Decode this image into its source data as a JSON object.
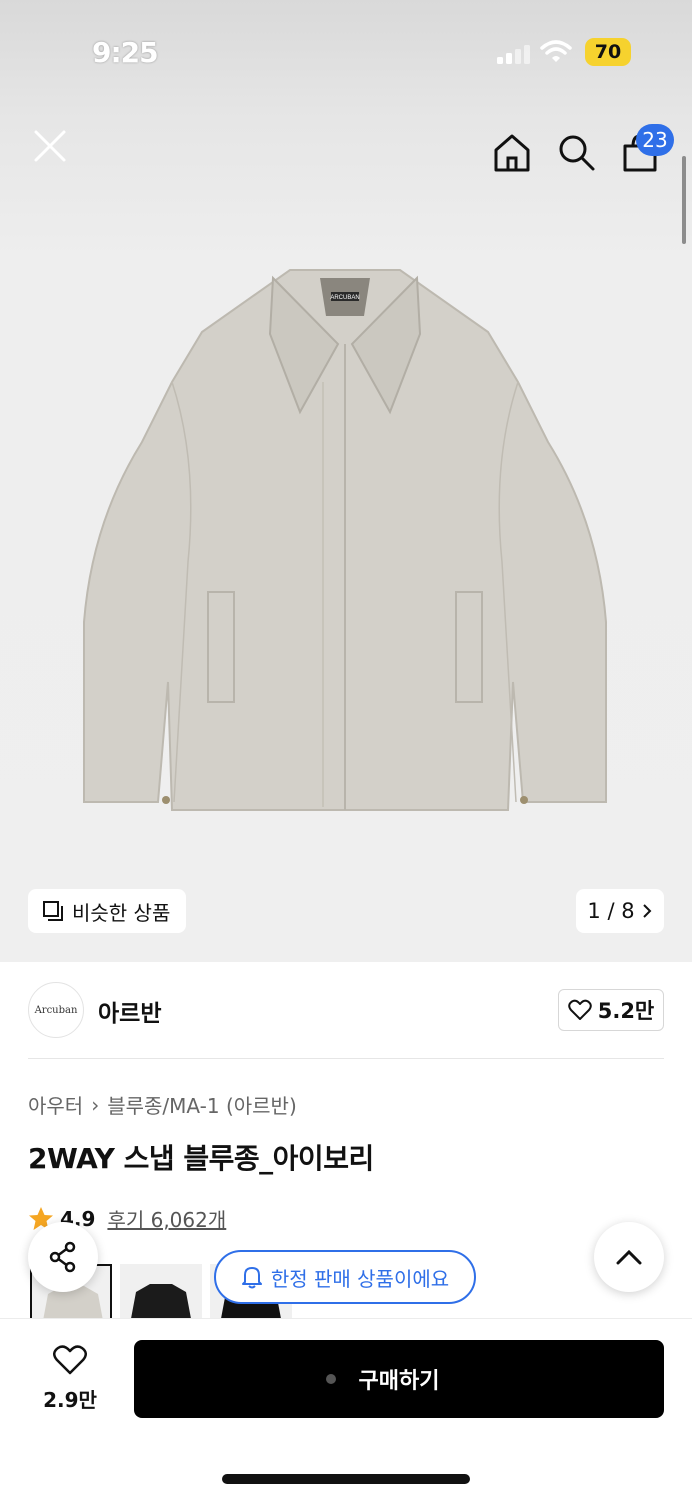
{
  "status_bar": {
    "time": "9:25",
    "battery": "70",
    "icons": [
      "cellular-signal-icon",
      "wifi-icon",
      "battery-icon"
    ]
  },
  "top_bar": {
    "icons": [
      "close-icon",
      "home-icon",
      "search-icon",
      "cart-icon"
    ],
    "cart_count": "23"
  },
  "gallery": {
    "similar_label": "비슷한 상품",
    "page_indicator": "1 / 8",
    "jacket_label": "ARCUBAN"
  },
  "brand": {
    "logo_text": "Arcuban",
    "name": "아르반",
    "like_count": "5.2만"
  },
  "product": {
    "breadcrumb": [
      "아우터",
      "블루종/MA-1 (아르반)"
    ],
    "title": "2WAY 스냅 블루종_아이보리",
    "rating": "4.9",
    "reviews": "후기 6,062개"
  },
  "overlay": {
    "limited_label": "한정 판매 상품이에요"
  },
  "bottom_bar": {
    "wish_count": "2.9만",
    "buy_label": "구매하기"
  },
  "colors": {
    "accent_blue": "#2f6fe8",
    "buy_black": "#000000",
    "star": "#f5a623",
    "battery_yellow": "#f6d22e"
  }
}
